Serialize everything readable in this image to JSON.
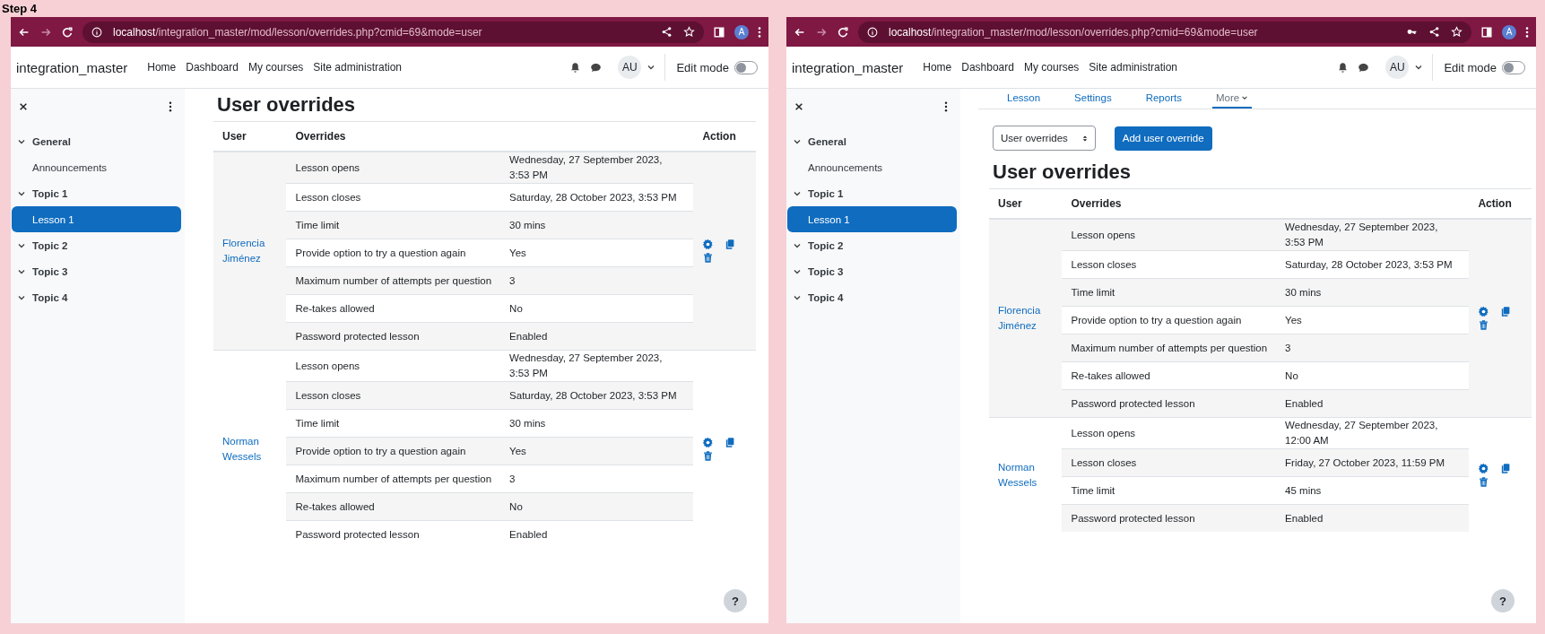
{
  "caption": "Step 4",
  "windows": [
    {
      "url": {
        "host": "localhost",
        "path": "/integration_master/mod/lesson/overrides.php?cmid=69&mode=user"
      },
      "key_icon": false,
      "profile_letter": "A",
      "site_name": "integration_master",
      "nav": [
        "Home",
        "Dashboard",
        "My courses",
        "Site administration"
      ],
      "user_initials": "AU",
      "edit_mode": {
        "label": "Edit mode",
        "on": false
      },
      "sidebar": [
        {
          "label": "General",
          "kind": "section",
          "selected": false
        },
        {
          "label": "Announcements",
          "kind": "activity",
          "selected": false
        },
        {
          "label": "Topic 1",
          "kind": "section",
          "selected": false
        },
        {
          "label": "Lesson 1",
          "kind": "activity",
          "selected": true
        },
        {
          "label": "Topic 2",
          "kind": "section",
          "selected": false
        },
        {
          "label": "Topic 3",
          "kind": "section",
          "selected": false
        },
        {
          "label": "Topic 4",
          "kind": "section",
          "selected": false
        }
      ],
      "heading": "User overrides",
      "columns": [
        "User",
        "Overrides",
        "Action"
      ],
      "rows": [
        {
          "user": "Florencia Jiménez",
          "settings": [
            {
              "name": "Lesson opens",
              "value": "Wednesday, 27 September 2023, 3:53 PM"
            },
            {
              "name": "Lesson closes",
              "value": "Saturday, 28 October 2023, 3:53 PM"
            },
            {
              "name": "Time limit",
              "value": "30 mins"
            },
            {
              "name": "Provide option to try a question again",
              "value": "Yes"
            },
            {
              "name": "Maximum number of attempts per question",
              "value": "3"
            },
            {
              "name": "Re-takes allowed",
              "value": "No"
            },
            {
              "name": "Password protected lesson",
              "value": "Enabled"
            }
          ]
        },
        {
          "user": "Norman Wessels",
          "settings": [
            {
              "name": "Lesson opens",
              "value": "Wednesday, 27 September 2023, 3:53 PM"
            },
            {
              "name": "Lesson closes",
              "value": "Saturday, 28 October 2023, 3:53 PM"
            },
            {
              "name": "Time limit",
              "value": "30 mins"
            },
            {
              "name": "Provide option to try a question again",
              "value": "Yes"
            },
            {
              "name": "Maximum number of attempts per question",
              "value": "3"
            },
            {
              "name": "Re-takes allowed",
              "value": "No"
            },
            {
              "name": "Password protected lesson",
              "value": "Enabled"
            }
          ]
        }
      ],
      "help": "?"
    },
    {
      "url": {
        "host": "localhost",
        "path": "/integration_master/mod/lesson/overrides.php?cmid=69&mode=user"
      },
      "key_icon": true,
      "profile_letter": "A",
      "site_name": "integration_master",
      "nav": [
        "Home",
        "Dashboard",
        "My courses",
        "Site administration"
      ],
      "user_initials": "AU",
      "edit_mode": {
        "label": "Edit mode",
        "on": false
      },
      "sidebar": [
        {
          "label": "General",
          "kind": "section",
          "selected": false
        },
        {
          "label": "Announcements",
          "kind": "activity",
          "selected": false
        },
        {
          "label": "Topic 1",
          "kind": "section",
          "selected": false
        },
        {
          "label": "Lesson 1",
          "kind": "activity",
          "selected": true
        },
        {
          "label": "Topic 2",
          "kind": "section",
          "selected": false
        },
        {
          "label": "Topic 3",
          "kind": "section",
          "selected": false
        },
        {
          "label": "Topic 4",
          "kind": "section",
          "selected": false
        }
      ],
      "tabs": [
        {
          "label": "Lesson",
          "selected": false,
          "menu": false
        },
        {
          "label": "Settings",
          "selected": false,
          "menu": false
        },
        {
          "label": "Reports",
          "selected": false,
          "menu": false
        },
        {
          "label": "More",
          "selected": true,
          "menu": true
        }
      ],
      "select": "User overrides",
      "add_button": "Add user override",
      "heading": "User overrides",
      "columns": [
        "User",
        "Overrides",
        "Action"
      ],
      "rows": [
        {
          "user": "Florencia Jiménez",
          "settings": [
            {
              "name": "Lesson opens",
              "value": "Wednesday, 27 September 2023, 3:53 PM"
            },
            {
              "name": "Lesson closes",
              "value": "Saturday, 28 October 2023, 3:53 PM"
            },
            {
              "name": "Time limit",
              "value": "30 mins"
            },
            {
              "name": "Provide option to try a question again",
              "value": "Yes"
            },
            {
              "name": "Maximum number of attempts per question",
              "value": "3"
            },
            {
              "name": "Re-takes allowed",
              "value": "No"
            },
            {
              "name": "Password protected lesson",
              "value": "Enabled"
            }
          ]
        },
        {
          "user": "Norman Wessels",
          "settings": [
            {
              "name": "Lesson opens",
              "value": "Wednesday, 27 September 2023, 12:00 AM"
            },
            {
              "name": "Lesson closes",
              "value": "Friday, 27 October 2023, 11:59 PM"
            },
            {
              "name": "Time limit",
              "value": "45 mins"
            },
            {
              "name": "Password protected lesson",
              "value": "Enabled"
            }
          ]
        }
      ],
      "help": "?"
    }
  ]
}
